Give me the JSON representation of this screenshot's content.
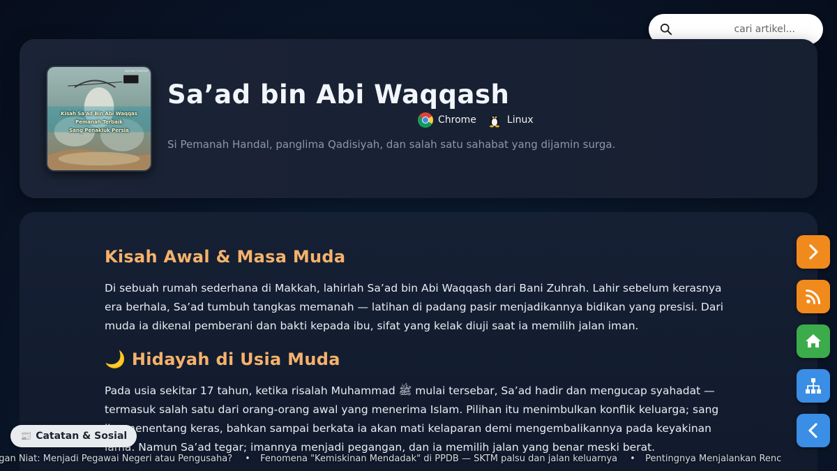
{
  "search": {
    "placeholder": "cari artikel..."
  },
  "article": {
    "title": "Sa’ad bin Abi Waqqash",
    "subtitle": "Si Pemanah Handal, panglima Qadisiyah, dan salah satu sahabat yang dijamin surga.",
    "thumbnail": {
      "caption_lines": [
        "Kisah Sa'ad Bin Abi Waqqas",
        "Pemanah Terbaik",
        "Sang Penakluk Persia"
      ],
      "badge": "Gambar Ilustrasi"
    },
    "platforms": [
      {
        "label": "Chrome",
        "icon": "chrome-icon"
      },
      {
        "label": "Linux",
        "icon": "linux-tux-icon"
      }
    ],
    "sections": [
      {
        "heading": "Kisah Awal & Masa Muda",
        "paragraph": "Di sebuah rumah sederhana di Makkah, lahirlah Sa’ad bin Abi Waqqash dari Bani Zuhrah. Lahir sebelum kerasnya era berhala, Sa’ad tumbuh tangkas memanah — latihan di padang pasir menjadikannya bidikan yang presisi. Dari muda ia dikenal pemberani dan bakti kepada ibu, sifat yang kelak diuji saat ia memilih jalan iman."
      },
      {
        "heading": "🌙 Hidayah di Usia Muda",
        "paragraph": "Pada usia sekitar 17 tahun, ketika risalah Muhammad ﷺ mulai tersebar, Sa’ad hadir dan mengucap syahadat — termasuk salah satu dari orang-orang awal yang menerima Islam. Pilihan itu menimbulkan konflik keluarga; sang ibu menentang keras, bahkan sampai berkata ia akan mati kelaparan demi mengembalikannya pada keyakinan lama. Namun Sa’ad tegar; imannya menjadi pegangan, dan ia memilih jalan yang benar meski berat."
      }
    ]
  },
  "category": {
    "icon": "📰",
    "label": "Catatan & Sosial"
  },
  "ticker": {
    "items": [
      "ngan Niat: Menjadi Pegawai Negeri atau Pengusaha?",
      "Fenomena \"Kemiskinan Mendadak\" di PPDB — SKTM palsu dan jalan keluarnya",
      "Pentingnya Menjalankan Renc"
    ]
  },
  "side_nav": {
    "next": "chevron-right-icon",
    "rss": "rss-icon",
    "home": "home-icon",
    "sitemap": "sitemap-icon",
    "back": "chevron-left-icon"
  },
  "colors": {
    "heading_accent": "#f5b26b",
    "orange_button": "#f18a1c",
    "green_button": "#3cab4b",
    "blue_button": "#3a8ee6"
  }
}
